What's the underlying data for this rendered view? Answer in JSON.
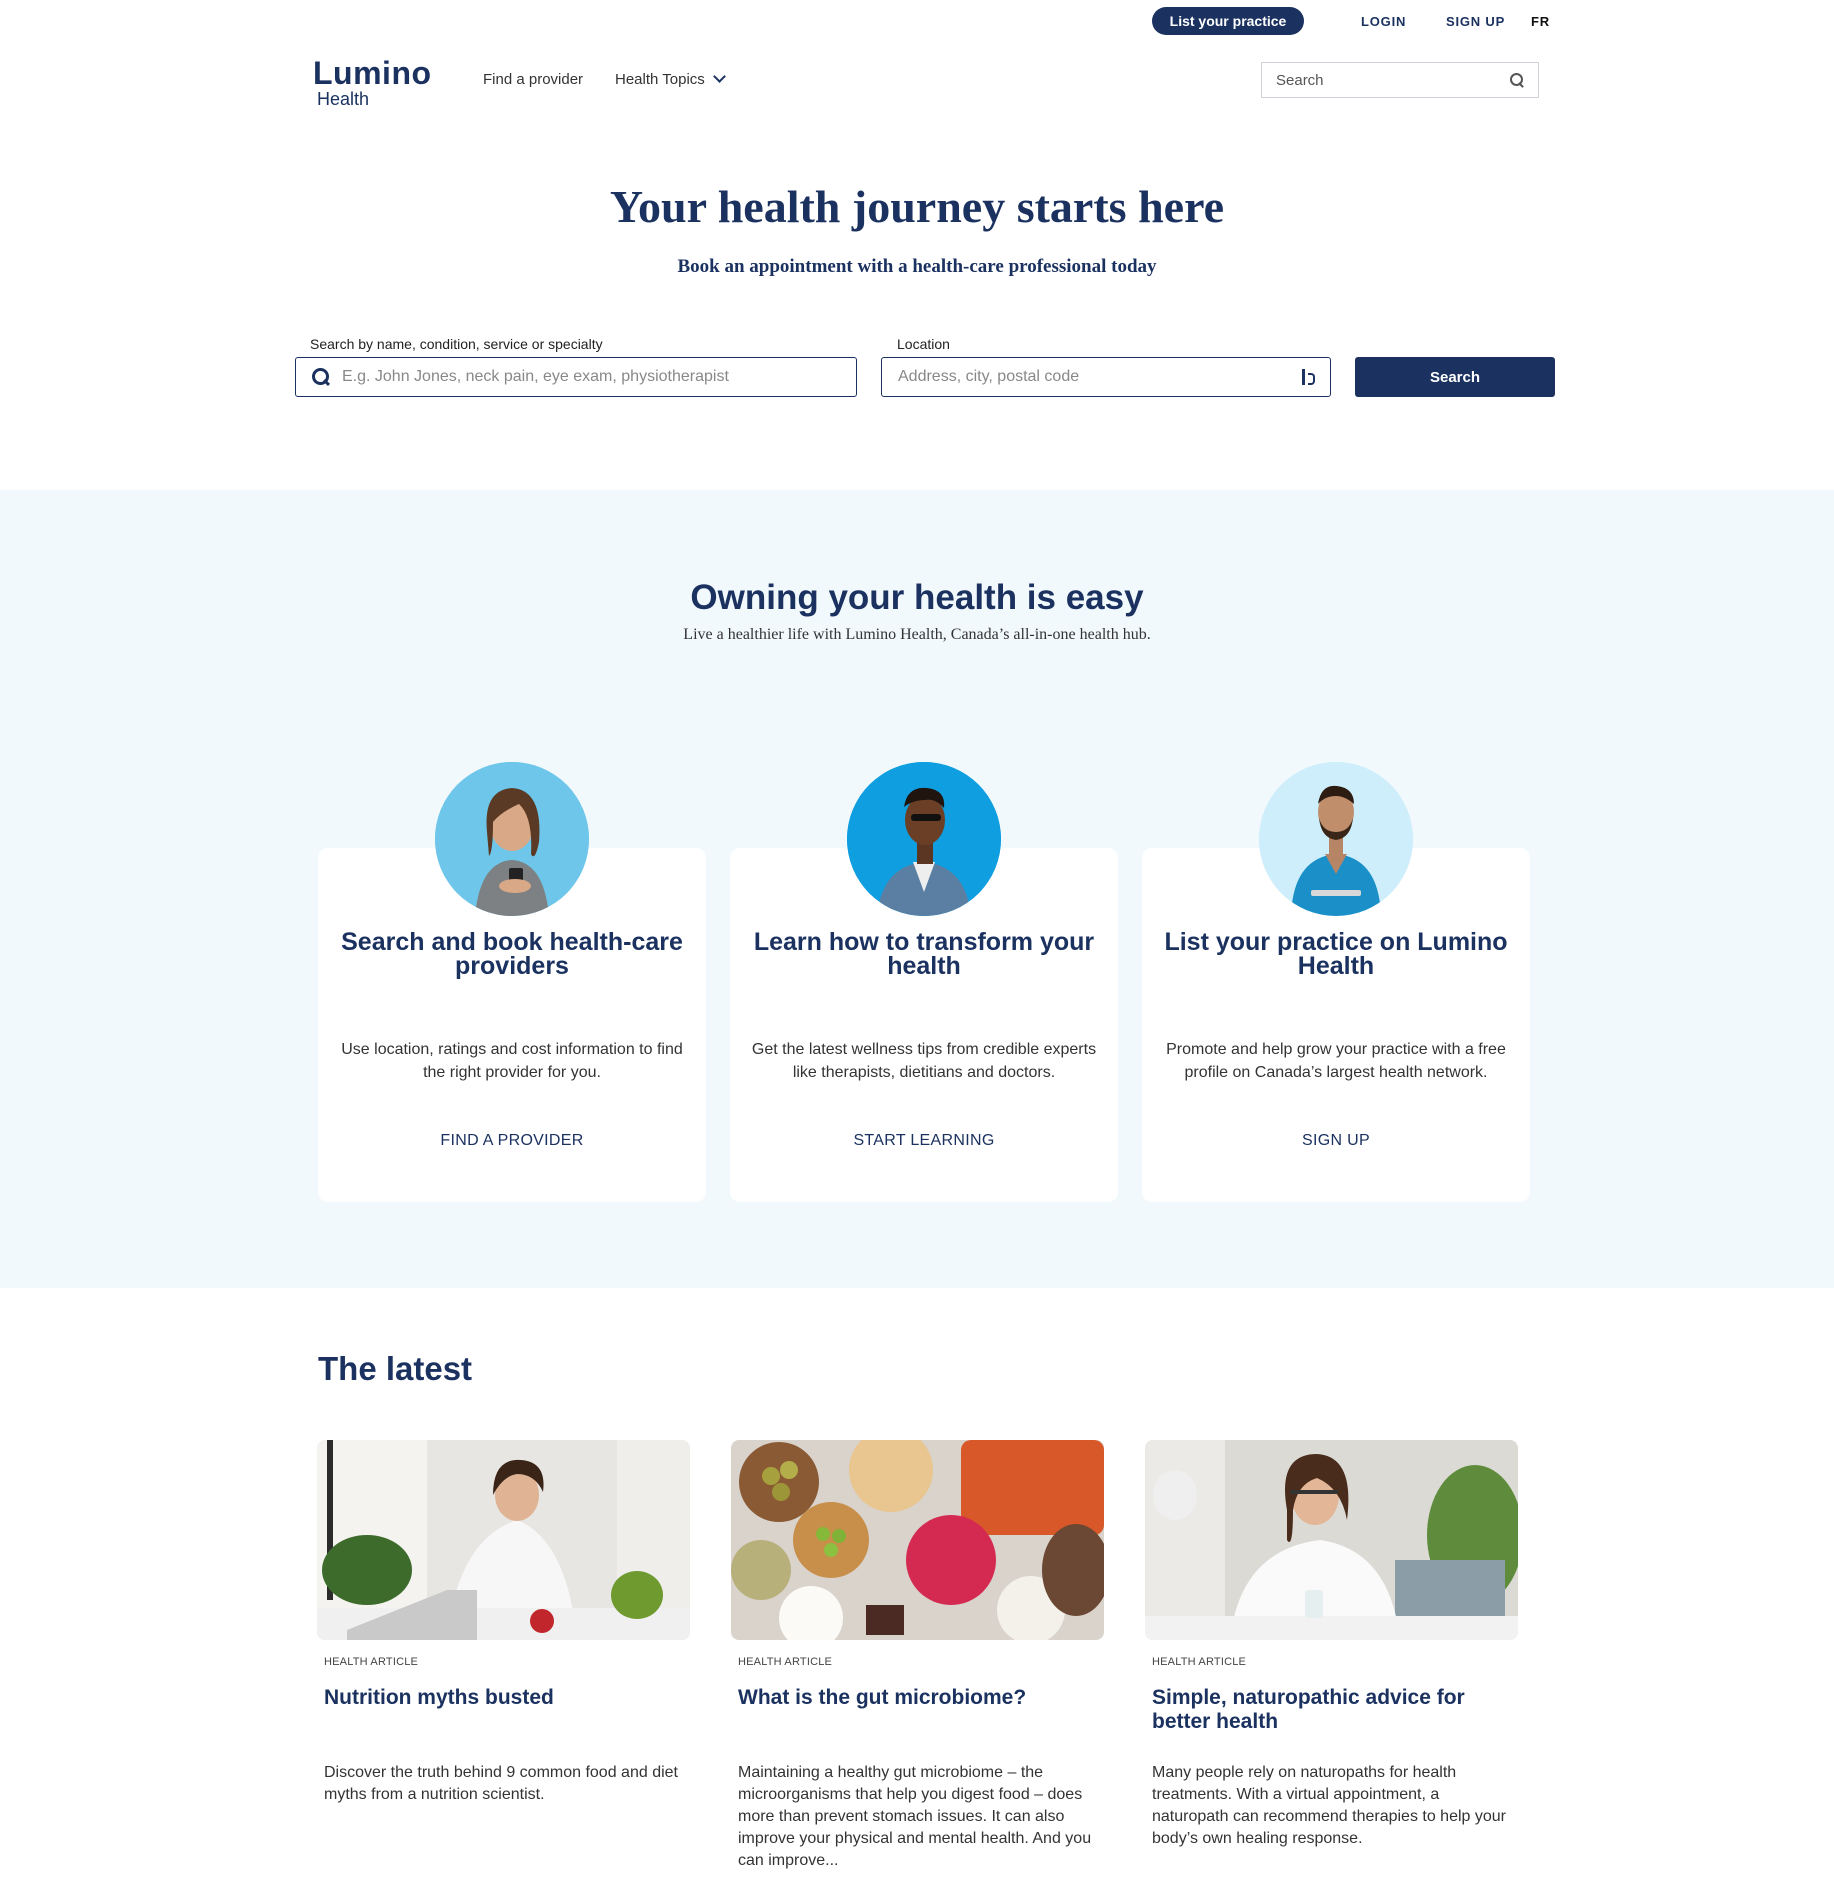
{
  "topbar": {
    "list_practice": "List your practice",
    "login": "LOGIN",
    "signup": "SIGN UP",
    "lang": "FR"
  },
  "header": {
    "brand": "Lumino",
    "brand_sub": "Health",
    "nav": {
      "find_provider": "Find a provider",
      "health_topics": "Health Topics"
    },
    "search_placeholder": "Search"
  },
  "hero": {
    "title": "Your health journey starts here",
    "subtitle": "Book an appointment with a health-care professional today",
    "query_label": "Search by name, condition, service or specialty",
    "query_placeholder": "E.g. John Jones, neck pain, eye exam, physiotherapist",
    "location_label": "Location",
    "location_placeholder": "Address, city, postal code",
    "search_button": "Search"
  },
  "owning": {
    "title": "Owning your health is easy",
    "subtitle": "Live a healthier life with Lumino Health, Canada’s all-in-one health hub.",
    "cards": [
      {
        "title": "Search and book health-care providers",
        "desc": "Use location, ratings and cost information to find the right provider for you.",
        "link": "FIND A PROVIDER"
      },
      {
        "title": "Learn how to transform your health",
        "desc": "Get the latest wellness tips from credible experts like therapists, dietitians and doctors.",
        "link": "START LEARNING"
      },
      {
        "title": "List your practice on Lumino Health",
        "desc": "Promote and help grow your practice with a free profile on Canada’s largest health network.",
        "link": "SIGN UP"
      }
    ]
  },
  "latest": {
    "title": "The latest",
    "articles": [
      {
        "tag": "HEALTH ARTICLE",
        "title": "Nutrition myths busted",
        "desc": "Discover the truth behind 9 common food and diet myths from a nutrition scientist."
      },
      {
        "tag": "HEALTH ARTICLE",
        "title": "What is the gut microbiome?",
        "desc": "Maintaining a healthy gut microbiome – the microorganisms that help you digest food – does more than prevent stomach issues. It can also improve your physical and mental health. And you can improve..."
      },
      {
        "tag": "HEALTH ARTICLE",
        "title": "Simple, naturopathic advice for better health",
        "desc": "Many people rely on naturopaths for health treatments. With a virtual appointment, a naturopath can recommend therapies to help your body’s own healing response."
      }
    ]
  },
  "colors": {
    "brand_navy": "#1b3260",
    "section_bg": "#f1f9fd"
  }
}
